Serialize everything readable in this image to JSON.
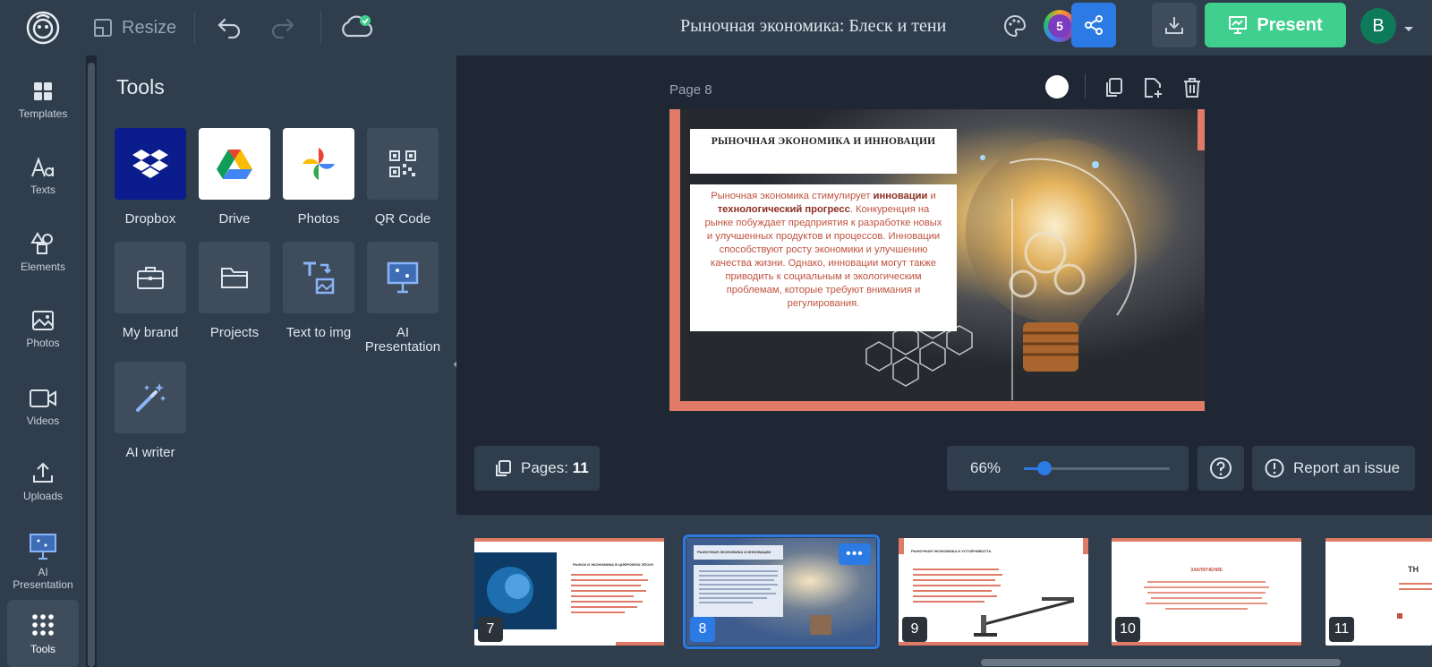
{
  "topbar": {
    "resize_label": "Resize",
    "document_title": "Рыночная экономика: Блеск и тени",
    "collab_count": "5",
    "present_label": "Present",
    "avatar_initial": "B"
  },
  "leftnav": {
    "items": [
      {
        "label": "Templates",
        "icon": "templates-icon"
      },
      {
        "label": "Texts",
        "icon": "text-icon"
      },
      {
        "label": "Elements",
        "icon": "elements-icon"
      },
      {
        "label": "Photos",
        "icon": "photo-icon"
      },
      {
        "label": "Videos",
        "icon": "video-icon"
      },
      {
        "label": "Uploads",
        "icon": "upload-icon"
      },
      {
        "label": "AI\nPresentation",
        "icon": "presentation-icon"
      },
      {
        "label": "Tools",
        "icon": "grid-icon",
        "active": true
      }
    ]
  },
  "tools": {
    "heading": "Tools",
    "items": [
      {
        "label": "Dropbox",
        "icon": "dropbox-icon"
      },
      {
        "label": "Drive",
        "icon": "google-drive-icon"
      },
      {
        "label": "Photos",
        "icon": "google-photos-icon"
      },
      {
        "label": "QR Code",
        "icon": "qr-code-icon"
      },
      {
        "label": "My brand",
        "icon": "briefcase-icon"
      },
      {
        "label": "Projects",
        "icon": "folder-icon"
      },
      {
        "label": "Text to img",
        "icon": "text-to-image-icon"
      },
      {
        "label": "AI Presentation",
        "icon": "presentation-icon"
      },
      {
        "label": "AI writer",
        "icon": "magic-wand-icon"
      }
    ]
  },
  "canvas": {
    "page_label": "Page 8",
    "slide": {
      "title": "РЫНОЧНАЯ ЭКОНОМИКА И ИННОВАЦИИ",
      "body_parts": [
        "Рыночная экономика стимулирует ",
        "инновации",
        " и ",
        "технологический прогресс",
        ". Конкуренция на рынке побуждает предприятия к разработке новых и улучшенных продуктов и процессов. Инновации способствуют росту экономики и улучшению качества жизни. Однако, инновации могут также приводить к социальным и экологическим проблемам, которые требуют внимания и регулирования."
      ],
      "accent_color": "#e07b67"
    }
  },
  "bottombar": {
    "pages_label": "Pages:",
    "pages_count": "11",
    "zoom_label": "66%",
    "zoom_fraction": 0.14,
    "report_label": "Report an issue"
  },
  "filmstrip": {
    "thumbs": [
      {
        "num": "7",
        "title": "РЫНОК И ЭКОНОМИКА В ЦИФРОВУЮ ЭПОХУ"
      },
      {
        "num": "8",
        "title": "РЫНОЧНАЯ ЭКОНОМИКА И ИННОВАЦИИ",
        "active": true,
        "more": "•••"
      },
      {
        "num": "9",
        "title": "РЫНОЧНАЯ ЭКОНОМИКА И УСТОЙЧИВОСТЬ"
      },
      {
        "num": "10",
        "title": "ЗАКЛЮЧЕНИЕ"
      },
      {
        "num": "11",
        "title": "TH"
      }
    ]
  },
  "colors": {
    "accent": "#2c7be5",
    "present": "#3fcf8e",
    "panel": "#2f3d4c",
    "workspace": "#1e2733"
  }
}
